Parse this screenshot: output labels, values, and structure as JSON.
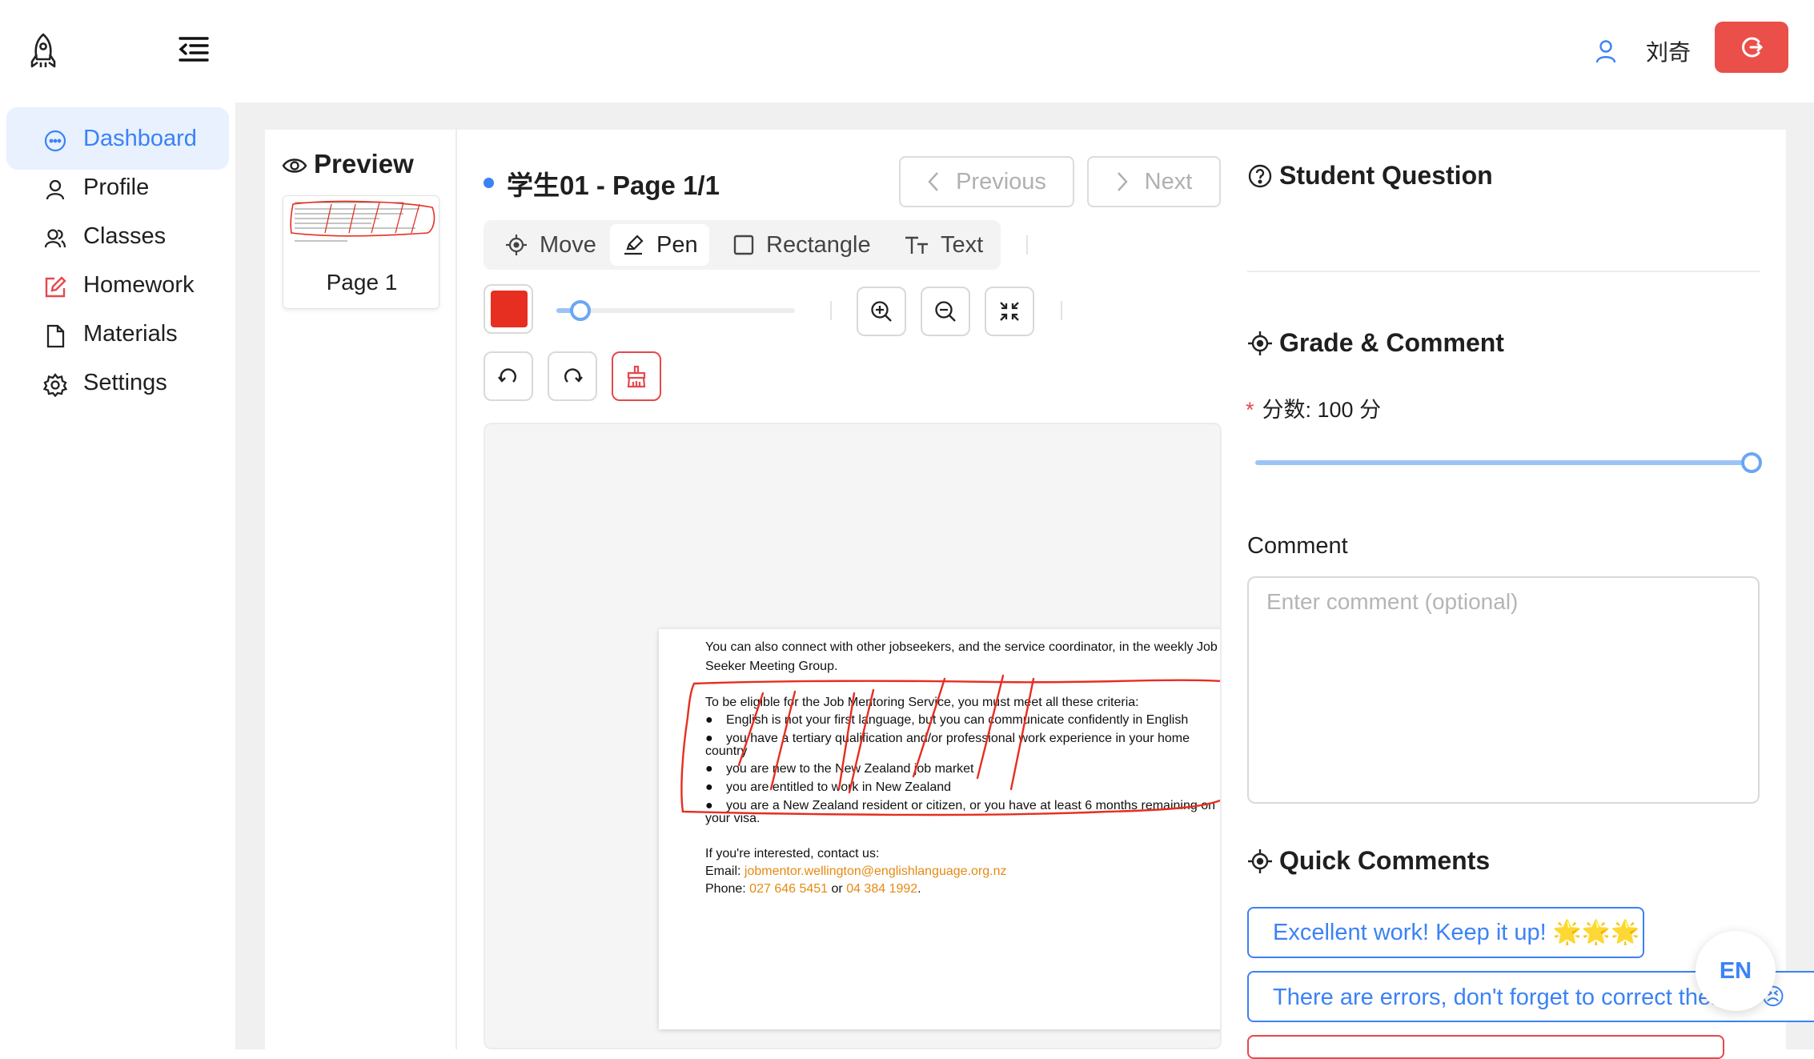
{
  "header": {
    "user_name": "刘奇"
  },
  "sidebar": {
    "items": [
      {
        "label": "Dashboard",
        "icon": "chat-bubble-icon",
        "active": true
      },
      {
        "label": "Profile",
        "icon": "user-icon"
      },
      {
        "label": "Classes",
        "icon": "users-icon"
      },
      {
        "label": "Homework",
        "icon": "edit-icon"
      },
      {
        "label": "Materials",
        "icon": "file-icon"
      },
      {
        "label": "Settings",
        "icon": "gear-icon"
      }
    ]
  },
  "preview": {
    "title": "Preview",
    "pages": [
      "Page 1"
    ]
  },
  "editor": {
    "page_title": "学生01 - Page 1/1",
    "previous_label": "Previous",
    "next_label": "Next",
    "tools": [
      "Move",
      "Pen",
      "Rectangle",
      "Text"
    ],
    "selected_tool": "Pen",
    "pen_color": "#e62e21",
    "brush_size_fraction": 0.07
  },
  "document": {
    "intro_line1": "You can also connect with other jobseekers, and the service coordinator, in the weekly Job",
    "intro_line2": "Seeker Meeting Group.",
    "criteria_heading": "To be eligible for the Job Mentoring Service, you must meet all these criteria:",
    "bullets": [
      "English is not your first language, but you can communicate confidently in English",
      "you have a tertiary qualification and/or professional work experience in your home",
      "you are new to the New Zealand job market",
      "you are entitled to work in New Zealand",
      "you are a New Zealand resident or citizen, or you have at least 6 months remaining on"
    ],
    "bullet2_cont": "country",
    "bullet5_cont": "your visa.",
    "contact_heading": "If you're interested, contact us:",
    "email_label": "Email:",
    "email": "jobmentor.wellington@englishlanguage.org.nz",
    "phone_label": "Phone:",
    "phone1": "027 646 5451",
    "phone_or": "or",
    "phone2": "04 384 1992",
    "phone_end": "."
  },
  "right_panel": {
    "question_title": "Student Question",
    "grade_title": "Grade & Comment",
    "score_label": "分数: 100 分",
    "score": 100,
    "comment_label": "Comment",
    "comment_placeholder": "Enter comment (optional)",
    "quick_title": "Quick Comments",
    "quick_comments": [
      "Excellent work! Keep it up! 🌟🌟🌟",
      "There are errors, don't forget to correct them 😣😣"
    ]
  },
  "language_button": "EN",
  "colors": {
    "accent": "#3b82f6",
    "logout": "#ea4f4a",
    "pen": "#e62e21"
  }
}
